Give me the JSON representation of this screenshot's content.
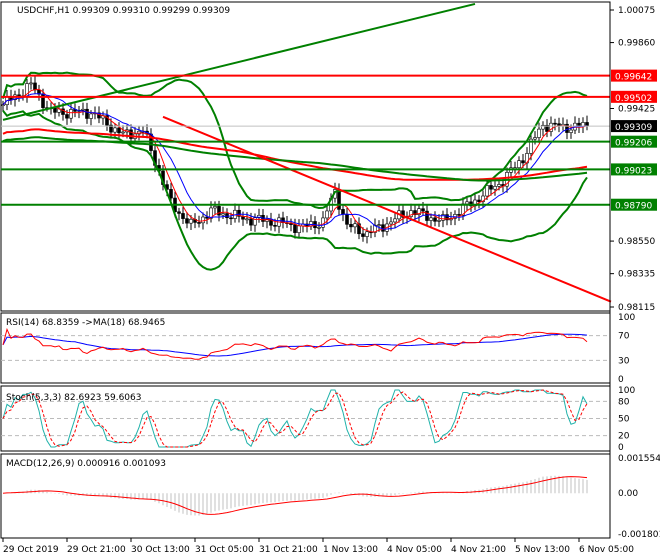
{
  "header": {
    "symbol": "USDCHF,H1",
    "ohlc": "0.99309 0.99310 0.99299 0.99309"
  },
  "chart_data": [
    {
      "type": "candlestick",
      "title": "USDCHF,H1 0.99309 0.99310 0.99299 0.99309",
      "ylim": [
        0.98115,
        1.00075
      ],
      "y_ticks": [
        "1.00075",
        "0.99860",
        "0.99425",
        "0.98550",
        "0.98335",
        "0.98115"
      ],
      "x_ticks": [
        "29 Oct 2019",
        "29 Oct 21:00",
        "30 Oct 13:00",
        "31 Oct 05:00",
        "31 Oct 21:00",
        "1 Nov 13:00",
        "4 Nov 05:00",
        "4 Nov 21:00",
        "5 Nov 13:00",
        "6 Nov 05:00"
      ],
      "close_anchors": [
        [
          0,
          0.9945
        ],
        [
          7,
          0.9958
        ],
        [
          12,
          0.994
        ],
        [
          22,
          0.994
        ],
        [
          30,
          0.9925
        ],
        [
          35,
          0.9928
        ],
        [
          37,
          0.9915
        ],
        [
          42,
          0.988
        ],
        [
          47,
          0.9865
        ],
        [
          52,
          0.9875
        ],
        [
          60,
          0.987
        ],
        [
          67,
          0.9868
        ],
        [
          75,
          0.9864
        ],
        [
          80,
          0.9868
        ],
        [
          83,
          0.9888
        ],
        [
          86,
          0.9865
        ],
        [
          91,
          0.986
        ],
        [
          97,
          0.9868
        ],
        [
          102,
          0.9875
        ],
        [
          110,
          0.9868
        ],
        [
          117,
          0.988
        ],
        [
          125,
          0.9895
        ],
        [
          130,
          0.991
        ],
        [
          135,
          0.9932
        ],
        [
          140,
          0.993
        ],
        [
          146,
          0.99309
        ]
      ],
      "levels": [
        {
          "label": "0.99642",
          "value": 0.99642,
          "color": "#ff0000"
        },
        {
          "label": "0.99502",
          "value": 0.99502,
          "color": "#ff0000"
        },
        {
          "label": "0.99309",
          "value": 0.99309,
          "color": "#000000"
        },
        {
          "label": "0.99206",
          "value": 0.99206,
          "color": "#008000"
        },
        {
          "label": "0.99023",
          "value": 0.99023,
          "color": "#008000"
        },
        {
          "label": "0.98790",
          "value": 0.9879,
          "color": "#008000"
        }
      ],
      "trendlines": [
        {
          "color": "#008000",
          "from": [
            0,
            0.9935
          ],
          "to": [
            118,
            1.00115
          ]
        },
        {
          "color": "#ff0000",
          "from": [
            40,
            0.9937
          ],
          "to": [
            152,
            0.9815
          ]
        }
      ]
    },
    {
      "type": "line",
      "title": "RSI(14) 68.8359 ->MA(18) 68.9465",
      "ylim": [
        0,
        100
      ],
      "y_ticks": [
        "100",
        "70",
        "30",
        "0"
      ],
      "levels": [
        70,
        30
      ],
      "series": [
        {
          "color": "#ff0000"
        },
        {
          "color": "#0000ff"
        }
      ]
    },
    {
      "type": "line",
      "title": "Stoch(5,3,3) 82.6923 59.6063",
      "ylim": [
        0,
        100
      ],
      "y_ticks": [
        "100",
        "80",
        "50",
        "20",
        "0"
      ],
      "levels": [
        80,
        50,
        20
      ],
      "series": [
        {
          "color": "#20b2aa"
        },
        {
          "color": "#ff0000"
        }
      ]
    },
    {
      "type": "bar",
      "title": "MACD(12,26,9) 0.000916 0.001093",
      "ylim": [
        -0.001801,
        0.001554
      ],
      "y_ticks": [
        "0.001554",
        "0.00",
        "-0.001801"
      ],
      "series": [
        {
          "color": "#c0c0c0"
        },
        {
          "color": "#ff0000"
        }
      ]
    }
  ]
}
